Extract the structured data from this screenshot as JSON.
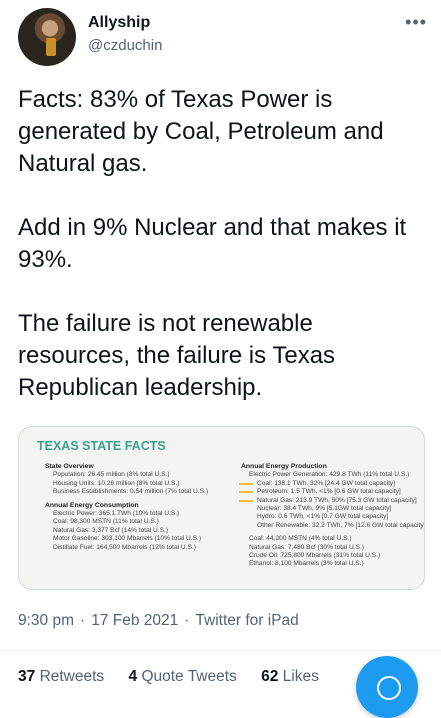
{
  "author": {
    "name": "Allyship",
    "handle": "@czduchin",
    "more_glyph": "•••"
  },
  "tweet": {
    "text": "Facts: 83% of Texas Power is generated by Coal, Petroleum and Natural gas.\n\nAdd in 9% Nuclear and that makes it 93%.\n\nThe failure is not renewable resources, the failure is Texas Republican leadership."
  },
  "media": {
    "title": "TEXAS STATE FACTS",
    "left": {
      "state_overview_title": "State Overview",
      "state_overview": [
        "Population: 26.45 million (8% total U.S.)",
        "Housing Units: 10.26 million (8% total U.S.)",
        "Business Establishments: 0.54 million (7% total U.S.)"
      ],
      "energy_consumption_title": "Annual Energy Consumption",
      "energy_consumption": [
        "Electric Power: 365.1 TWh (10% total U.S.)",
        "Coal: 98,300 MSTN (11% total U.S.)",
        "Natural Gas: 3,377 Bcf (14% total U.S.)",
        "Motor Gasoline: 303,100 Mbarrels (10% total U.S.)",
        "Distillate Fuel: 164,500 Mbarrels (12% total U.S.)"
      ]
    },
    "right": {
      "production_title": "Annual Energy Production",
      "generation_total": "Electric Power Generation: 429.8 TWh (11% total U.S.)",
      "generation_breakdown": [
        "Coal: 138.1 TWh, 32% [24.4 GW total capacity]",
        "Petroleum: 1.5 TWh, <1% [0.6 GW total capacity]",
        "Natural Gas: 213.9 TWh, 50% [75.3 GW total capacity]",
        "Nuclear: 38.4 TWh, 9% [5.1GW total capacity]",
        "Hydro: 0.6 TWh, <1% [0.7 GW total capacity]",
        "Other Renewable: 32.2 TWh, 7% [12.6 GW total capacity]"
      ],
      "other_production": [
        "Coal: 44,200 MSTN (4% total U.S.)",
        "Natural Gas: 7,480 Bcf (30% total U.S.)",
        "Crude Oil: 725,800 Mbarrels (31% total U.S.)",
        "Ethanol: 8,100 Mbarrels (3% total U.S.)"
      ]
    }
  },
  "meta": {
    "time": "9:30 pm",
    "date": "17 Feb 2021",
    "source": "Twitter for iPad",
    "separator": "·"
  },
  "stats": {
    "retweets_count": "37",
    "retweets_label": "Retweets",
    "quotes_count": "4",
    "quotes_label": "Quote Tweets",
    "likes_count": "62",
    "likes_label": "Likes"
  },
  "colors": {
    "accent": "#1d9bf0",
    "media_title": "#3aa18a",
    "highlight_arrow": "#f0c030"
  },
  "icons": {
    "fab": "compose-icon",
    "avatar": "avatar-photo"
  }
}
